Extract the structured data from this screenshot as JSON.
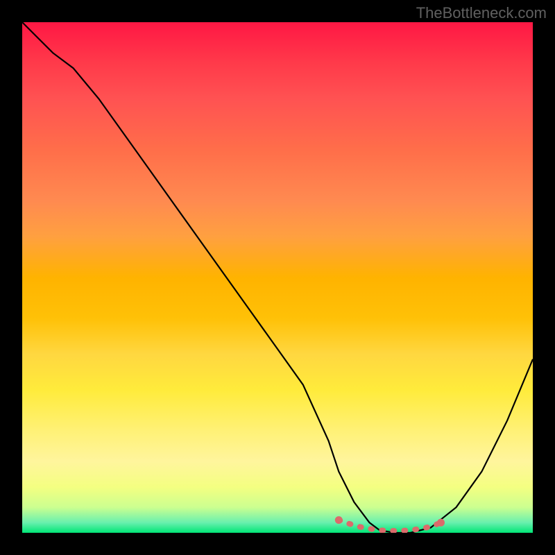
{
  "watermark": "TheBottleneck.com",
  "chart_data": {
    "type": "line",
    "title": "",
    "xlabel": "",
    "ylabel": "",
    "xlim": [
      0,
      100
    ],
    "ylim": [
      0,
      100
    ],
    "grid": false,
    "legend": false,
    "background_gradient": {
      "top_color": "#ff1744",
      "bottom_color": "#00e676",
      "description": "vertical red-orange-yellow-green gradient"
    },
    "series": [
      {
        "name": "bottleneck-curve",
        "color": "#000000",
        "x": [
          0,
          3,
          6,
          10,
          15,
          20,
          25,
          30,
          35,
          40,
          45,
          50,
          55,
          60,
          62,
          65,
          68,
          70,
          73,
          76,
          80,
          85,
          90,
          95,
          100
        ],
        "y": [
          100,
          97,
          94,
          91,
          85,
          78,
          71,
          64,
          57,
          50,
          43,
          36,
          29,
          18,
          12,
          6,
          2,
          0.5,
          0,
          0,
          1,
          5,
          12,
          22,
          34
        ]
      },
      {
        "name": "highlight-band",
        "color": "#e57373",
        "type": "scatter",
        "x": [
          62,
          64,
          66,
          68,
          70,
          72,
          74,
          76,
          78,
          80,
          82
        ],
        "y": [
          2.5,
          1.8,
          1.2,
          0.8,
          0.5,
          0.4,
          0.4,
          0.5,
          0.8,
          1.2,
          2.0
        ]
      }
    ]
  }
}
